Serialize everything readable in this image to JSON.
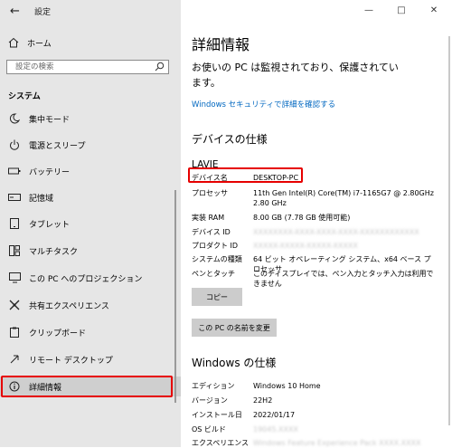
{
  "app": {
    "title": "設定"
  },
  "sidebar": {
    "home_label": "ホーム",
    "search_placeholder": "設定の検索",
    "section": "システム",
    "items": [
      {
        "label": "集中モード",
        "icon": "moon-icon"
      },
      {
        "label": "電源とスリープ",
        "icon": "power-icon"
      },
      {
        "label": "バッテリー",
        "icon": "battery-icon"
      },
      {
        "label": "記憶域",
        "icon": "storage-icon"
      },
      {
        "label": "タブレット",
        "icon": "tablet-icon"
      },
      {
        "label": "マルチタスク",
        "icon": "multitask-icon"
      },
      {
        "label": "この PC へのプロジェクション",
        "icon": "projection-icon"
      },
      {
        "label": "共有エクスペリエンス",
        "icon": "share-icon"
      },
      {
        "label": "クリップボード",
        "icon": "clipboard-icon"
      },
      {
        "label": "リモート デスクトップ",
        "icon": "remote-icon"
      },
      {
        "label": "詳細情報",
        "icon": "info-icon",
        "selected": true
      }
    ]
  },
  "main": {
    "title": "詳細情報",
    "protect_text": "お使いの PC は監視されており、保護されています。",
    "security_link": "Windows セキュリティで詳細を確認する",
    "device_specs": {
      "title": "デバイスの仕様",
      "device_label": "LAVIE",
      "rows": [
        {
          "key": "デバイス名",
          "value": "DESKTOP-PC"
        },
        {
          "key": "プロセッサ",
          "value": "11th Gen Intel(R) Core(TM) i7-1165G7 @ 2.80GHz 2.80 GHz"
        },
        {
          "key": "実装 RAM",
          "value": "8.00 GB (7.78 GB 使用可能)"
        },
        {
          "key": "デバイス ID",
          "value": "XXXXXXXX-XXXX-XXXX-XXXX-XXXXXXXXXXXX"
        },
        {
          "key": "プロダクト ID",
          "value": "XXXXX-XXXXX-XXXXX-XXXXX"
        },
        {
          "key": "システムの種類",
          "value": "64 ビット オペレーティング システム、x64 ベース プロセッサ"
        },
        {
          "key": "ペンとタッチ",
          "value": "このディスプレイでは、ペン入力とタッチ入力は利用できません"
        }
      ],
      "copy_button": "コピー",
      "rename_button": "この PC の名前を変更"
    },
    "windows_specs": {
      "title": "Windows の仕様",
      "rows": [
        {
          "key": "エディション",
          "value": "Windows 10 Home"
        },
        {
          "key": "バージョン",
          "value": "22H2"
        },
        {
          "key": "インストール日",
          "value": "2022/01/17"
        },
        {
          "key": "OS ビルド",
          "value": "19045.XXXX"
        },
        {
          "key": "エクスペリエンス",
          "value": "Windows Feature Experience Pack XXXX.XXXX"
        }
      ]
    }
  },
  "colors": {
    "sidebar_bg": "#e6e6e6",
    "link": "#0067c0",
    "highlight": "#e60000",
    "button": "#cccccc"
  }
}
